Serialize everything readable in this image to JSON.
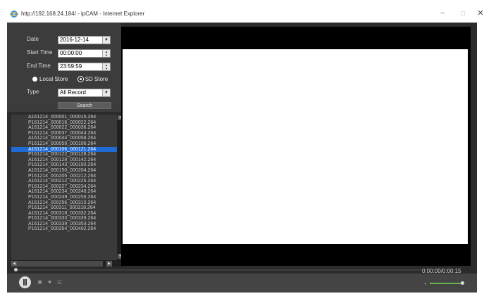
{
  "window": {
    "title": "http://192.168.24.184/ - ipCAM - Internet Explorer",
    "minimize_glyph": "–",
    "maximize_glyph": "□",
    "close_glyph": "✕"
  },
  "form": {
    "date_label": "Date",
    "date_value": "2016-12-14",
    "start_label": "Start Time",
    "start_value": "00:00:00",
    "end_label": "End Time",
    "end_value": "23:59:59",
    "local_store_label": "Local Store",
    "sd_store_label": "SD Store",
    "selected_store": "SD Store",
    "type_label": "Type",
    "type_value": "All Record",
    "search_label": "Search"
  },
  "files": [
    "A161214_000001_000015.264",
    "P161214_000016_000022.264",
    "A161214_000022_000036.264",
    "P161214_000037_000044.264",
    "A161214_000044_000058.264",
    "P161214_000059_000106.264",
    "A161214_000106_000121.264",
    "P161214_000122_000128.264",
    "A161214_000128_000142.264",
    "P161214_000143_000150.264",
    "A161214_000150_000204.264",
    "P161214_000205_000212.264",
    "A161214_000212_000226.264",
    "P161214_000227_000234.264",
    "A161214_000234_000248.264",
    "P161214_000249_000256.264",
    "A161214_000256_000310.264",
    "P161214_000311_000318.264",
    "A161214_000318_000332.264",
    "P161214_000333_000339.264",
    "A161214_000339_000353.264",
    "P161214_000354_000402.264"
  ],
  "selected_file_index": 6,
  "playback": {
    "time_readout": "0:00:00/0:00:15",
    "progress": 0.0,
    "volume": 0.95
  },
  "icons": {
    "browser": "ie-icon",
    "pause": "pause-icon",
    "snapshot": "camera-icon",
    "record": "record-icon",
    "fullscreen": "fullscreen-icon"
  }
}
